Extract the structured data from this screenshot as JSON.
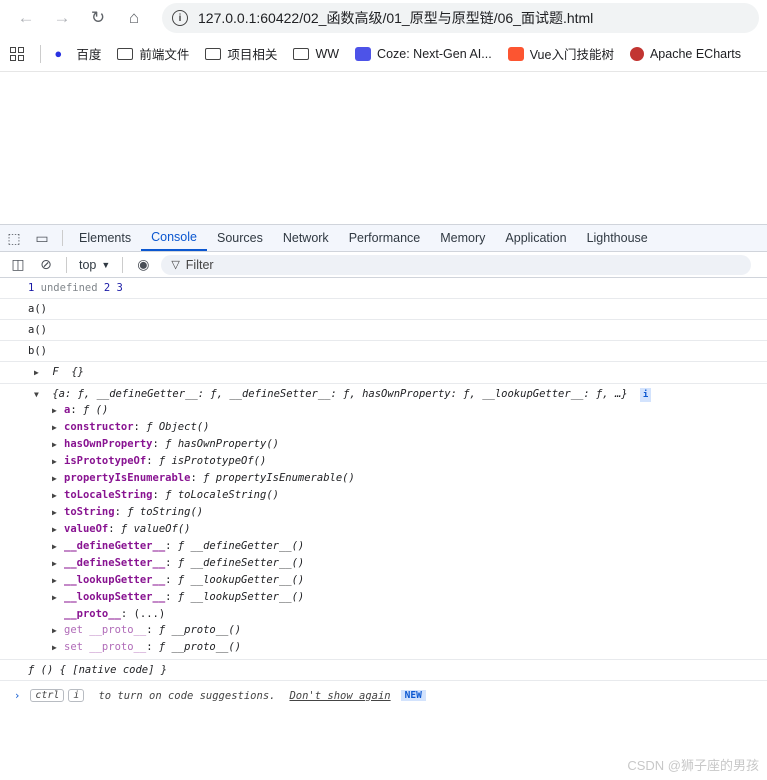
{
  "browser": {
    "url": "127.0.0.1:60422/02_函数高级/01_原型与原型链/06_面试题.html"
  },
  "bookmarks": [
    {
      "label": "百度",
      "icon": "baidu-paw-icon"
    },
    {
      "label": "前端文件",
      "icon": "folder-icon"
    },
    {
      "label": "项目相关",
      "icon": "folder-icon"
    },
    {
      "label": "WW",
      "icon": "folder-icon"
    },
    {
      "label": "Coze: Next-Gen AI...",
      "icon": "coze-icon"
    },
    {
      "label": "Vue入门技能树",
      "icon": "csdn-icon"
    },
    {
      "label": "Apache ECharts",
      "icon": "echarts-icon"
    }
  ],
  "devtools": {
    "tabs": [
      "Elements",
      "Console",
      "Sources",
      "Network",
      "Performance",
      "Memory",
      "Application",
      "Lighthouse"
    ],
    "active_tab": "Console",
    "context": "top",
    "filter_placeholder": "Filter"
  },
  "console": {
    "line1": {
      "a": "1",
      "b": "undefined",
      "c": "2",
      "d": "3"
    },
    "line2": "a()",
    "line3": "a()",
    "line4": "b()",
    "line5_label": "F",
    "line5_value": "{}",
    "object_summary": "{a: ƒ, __defineGetter__: ƒ, __defineSetter__: ƒ, hasOwnProperty: ƒ, __lookupGetter__: ƒ, …}",
    "info_badge": "i",
    "props": [
      {
        "key": "a",
        "value": "ƒ ()"
      },
      {
        "key": "constructor",
        "value": "ƒ Object()"
      },
      {
        "key": "hasOwnProperty",
        "value": "ƒ hasOwnProperty()"
      },
      {
        "key": "isPrototypeOf",
        "value": "ƒ isPrototypeOf()"
      },
      {
        "key": "propertyIsEnumerable",
        "value": "ƒ propertyIsEnumerable()"
      },
      {
        "key": "toLocaleString",
        "value": "ƒ toLocaleString()"
      },
      {
        "key": "toString",
        "value": "ƒ toString()"
      },
      {
        "key": "valueOf",
        "value": "ƒ valueOf()"
      },
      {
        "key": "__defineGetter__",
        "value": "ƒ __defineGetter__()"
      },
      {
        "key": "__defineSetter__",
        "value": "ƒ __defineSetter__()"
      },
      {
        "key": "__lookupGetter__",
        "value": "ƒ __lookupGetter__()"
      },
      {
        "key": "__lookupSetter__",
        "value": "ƒ __lookupSetter__()"
      }
    ],
    "proto_key": "__proto__",
    "proto_value": "(...)",
    "getter_label": "get __proto__",
    "getter_value": "ƒ __proto__()",
    "setter_label": "set __proto__",
    "setter_value": "ƒ __proto__()",
    "native_code": "ƒ () { [native code] }",
    "suggest_key1": "ctrl",
    "suggest_key2": "i",
    "suggest_text": "to turn on code suggestions.",
    "suggest_link": "Don't show again",
    "suggest_badge": "NEW"
  },
  "watermark": "CSDN @狮子座的男孩"
}
